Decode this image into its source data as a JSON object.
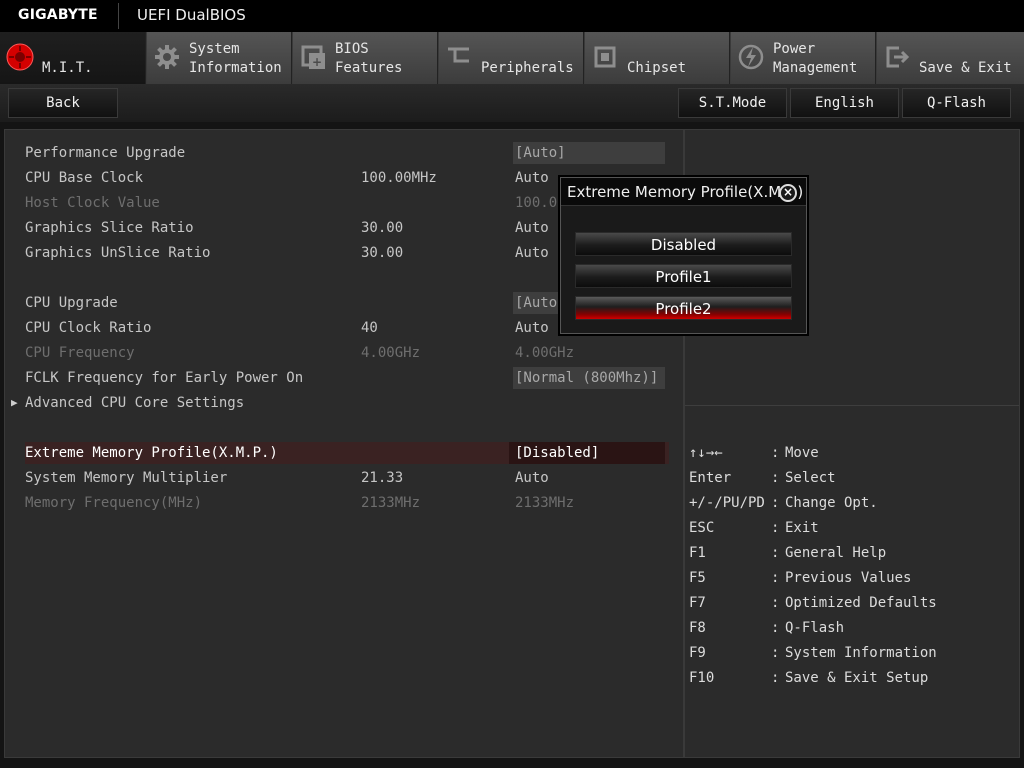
{
  "header": {
    "brand": "GIGABYTE",
    "title": "UEFI DualBIOS"
  },
  "tabs": [
    {
      "id": "mit",
      "label": "M.I.T.",
      "icon": "mit-icon",
      "active": true
    },
    {
      "id": "system-information",
      "label": "System\nInformation",
      "icon": "gear-icon",
      "active": false
    },
    {
      "id": "bios-features",
      "label": "BIOS\nFeatures",
      "icon": "bios-chip-icon",
      "active": false
    },
    {
      "id": "peripherals",
      "label": "Peripherals",
      "icon": "peripherals-icon",
      "active": false
    },
    {
      "id": "chipset",
      "label": "Chipset",
      "icon": "chipset-icon",
      "active": false
    },
    {
      "id": "power-management",
      "label": "Power\nManagement",
      "icon": "power-icon",
      "active": false
    },
    {
      "id": "save-exit",
      "label": "Save & Exit",
      "icon": "exit-icon",
      "active": false
    }
  ],
  "toolbar": {
    "back": "Back",
    "st_mode": "S.T.Mode",
    "language": "English",
    "qflash": "Q-Flash"
  },
  "settings": [
    {
      "label": "Performance Upgrade",
      "current": "",
      "value": "[Auto]",
      "boxed": true,
      "dim": false
    },
    {
      "label": "CPU Base Clock",
      "current": "100.00MHz",
      "value": "Auto",
      "boxed": false,
      "dim": false
    },
    {
      "label": "Host Clock Value",
      "current": "",
      "value": "100.00",
      "boxed": false,
      "dim": true
    },
    {
      "label": "Graphics Slice Ratio",
      "current": "30.00",
      "value": "Auto",
      "boxed": false,
      "dim": false
    },
    {
      "label": "Graphics UnSlice Ratio",
      "current": "30.00",
      "value": "Auto",
      "boxed": false,
      "dim": false
    },
    {
      "label": "CPU Upgrade",
      "current": "",
      "value": "[Auto]",
      "boxed": true,
      "dim": false
    },
    {
      "label": "CPU Clock Ratio",
      "current": "40",
      "value": "Auto",
      "boxed": false,
      "dim": false
    },
    {
      "label": "CPU Frequency",
      "current": "4.00GHz",
      "value": "4.00GHz",
      "boxed": false,
      "dim": true
    },
    {
      "label": "FCLK Frequency for Early Power On",
      "current": "",
      "value": "[Normal (800Mhz)]",
      "boxed": true,
      "dim": false
    },
    {
      "label": "Advanced CPU Core Settings",
      "current": "",
      "value": "",
      "boxed": false,
      "dim": false,
      "submenu": true
    },
    {
      "label": "Extreme Memory Profile(X.M.P.)",
      "current": "",
      "value": "[Disabled]",
      "boxed": true,
      "dim": false,
      "selected": true
    },
    {
      "label": "System Memory Multiplier",
      "current": "21.33",
      "value": "Auto",
      "boxed": false,
      "dim": false
    },
    {
      "label": "Memory Frequency(MHz)",
      "current": "2133MHz",
      "value": "2133MHz",
      "boxed": false,
      "dim": true
    }
  ],
  "keys": [
    {
      "key": "↑↓→←",
      "desc": "Move"
    },
    {
      "key": "Enter",
      "desc": "Select"
    },
    {
      "key": "+/-/PU/PD",
      "desc": "Change Opt."
    },
    {
      "key": "ESC",
      "desc": "Exit"
    },
    {
      "key": "F1",
      "desc": "General Help"
    },
    {
      "key": "F5",
      "desc": "Previous Values"
    },
    {
      "key": "F7",
      "desc": "Optimized Defaults"
    },
    {
      "key": "F8",
      "desc": "Q-Flash"
    },
    {
      "key": "F9",
      "desc": "System Information"
    },
    {
      "key": "F10",
      "desc": "Save & Exit Setup"
    }
  ],
  "popup": {
    "title": "Extreme Memory Profile(X.M.P.)",
    "options": [
      {
        "label": "Disabled",
        "highlighted": false
      },
      {
        "label": "Profile1",
        "highlighted": false
      },
      {
        "label": "Profile2",
        "highlighted": true
      }
    ]
  },
  "colors": {
    "accent_red": "#d00000",
    "background": "#141414",
    "panel": "#2b2b2b"
  }
}
